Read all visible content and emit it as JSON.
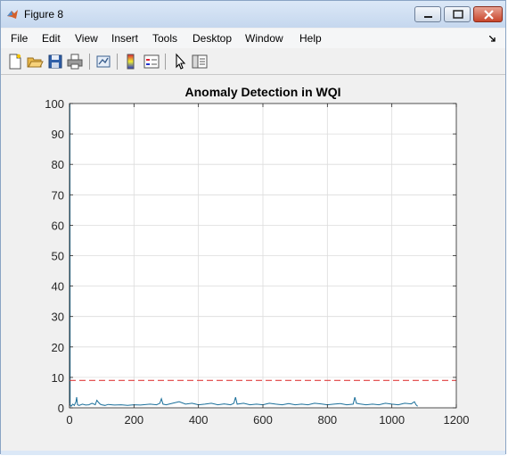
{
  "window": {
    "title": "Figure 8"
  },
  "menu": [
    "File",
    "Edit",
    "View",
    "Insert",
    "Tools",
    "Desktop",
    "Window",
    "Help"
  ],
  "toolbar_icons": [
    "new-figure-icon",
    "open-file-icon",
    "save-icon",
    "print-icon",
    "link-plot-icon",
    "colorbar-icon",
    "legend-icon",
    "edit-plot-icon",
    "property-editor-icon"
  ],
  "colors": {
    "series": "#1a6f9a",
    "threshold": "#e04040",
    "grid": "#dcdcdc"
  },
  "chart_data": {
    "type": "line",
    "title": "Anomaly Detection in WQI",
    "xlabel": "",
    "ylabel": "",
    "xlim": [
      0,
      1200
    ],
    "ylim": [
      0,
      100
    ],
    "xticks": [
      0,
      200,
      400,
      600,
      800,
      1000,
      1200
    ],
    "yticks": [
      0,
      10,
      20,
      30,
      40,
      50,
      60,
      70,
      80,
      90,
      100
    ],
    "grid": true,
    "series": [
      {
        "style": "solid",
        "x": [
          0,
          1,
          2,
          5,
          10,
          15,
          20,
          22,
          25,
          30,
          40,
          50,
          60,
          70,
          80,
          85,
          90,
          95,
          100,
          110,
          120,
          140,
          160,
          180,
          200,
          220,
          250,
          270,
          280,
          285,
          290,
          300,
          320,
          340,
          360,
          380,
          400,
          420,
          440,
          460,
          480,
          500,
          510,
          515,
          520,
          540,
          560,
          580,
          600,
          620,
          640,
          660,
          680,
          700,
          720,
          740,
          760,
          780,
          800,
          820,
          840,
          860,
          880,
          885,
          890,
          900,
          920,
          940,
          960,
          980,
          1000,
          1020,
          1040,
          1060,
          1070,
          1075,
          1080
        ],
        "y": [
          1.5,
          100,
          1.0,
          0.5,
          1.2,
          0.8,
          2.0,
          3.5,
          1.0,
          0.8,
          1.2,
          0.9,
          1.0,
          1.5,
          1.0,
          2.5,
          1.8,
          1.2,
          1.0,
          0.8,
          1.1,
          0.9,
          1.0,
          0.8,
          1.0,
          0.9,
          1.2,
          1.0,
          1.5,
          3.0,
          1.2,
          1.0,
          1.5,
          2.0,
          1.2,
          1.5,
          1.0,
          1.2,
          1.5,
          1.0,
          1.3,
          1.0,
          1.5,
          3.5,
          1.2,
          1.5,
          1.0,
          1.2,
          1.0,
          1.5,
          1.2,
          1.0,
          1.4,
          1.0,
          1.2,
          1.0,
          1.5,
          1.3,
          1.0,
          1.2,
          1.4,
          1.0,
          1.2,
          3.5,
          1.5,
          1.3,
          1.0,
          1.2,
          1.0,
          1.5,
          1.2,
          1.0,
          1.5,
          1.3,
          2.0,
          1.0,
          0.5
        ]
      },
      {
        "style": "dashed",
        "x": [
          0,
          1200
        ],
        "y": [
          9,
          9
        ]
      }
    ]
  }
}
